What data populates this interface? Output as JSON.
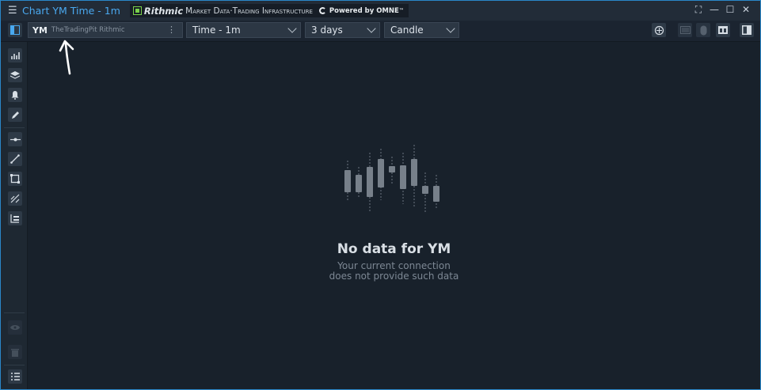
{
  "titlebar": {
    "title": "Chart YM Time - 1m",
    "brand_name": "Rithmic",
    "brand_tagline": "Market Data·Trading Infrastructure",
    "brand_powered": "Powered by OMNE",
    "trademark": "™"
  },
  "toolbar": {
    "symbol": "YM",
    "connection": "TheTradingPit Rithmic",
    "timeframe": "Time - 1m",
    "range": "3 days",
    "style": "Candle"
  },
  "main": {
    "title": "No data for YM",
    "line1": "Your current connection",
    "line2": "does not provide such data"
  },
  "colors": {
    "accent": "#4aa9f0",
    "window_border": "#2a87c9",
    "brand_green": "#7ad14a"
  },
  "icons": {
    "window_controls": [
      "fullscreen-icon",
      "minimize-icon",
      "maximize-icon",
      "close-icon"
    ],
    "sidebar_tools": [
      "indicators-icon",
      "layers-icon",
      "alerts-icon",
      "draw-icon",
      "horizontal-line-icon",
      "trend-line-icon",
      "rectangle-icon",
      "fibonacci-icon",
      "object-list-icon",
      "visibility-icon",
      "trash-icon",
      "list-icon"
    ]
  }
}
